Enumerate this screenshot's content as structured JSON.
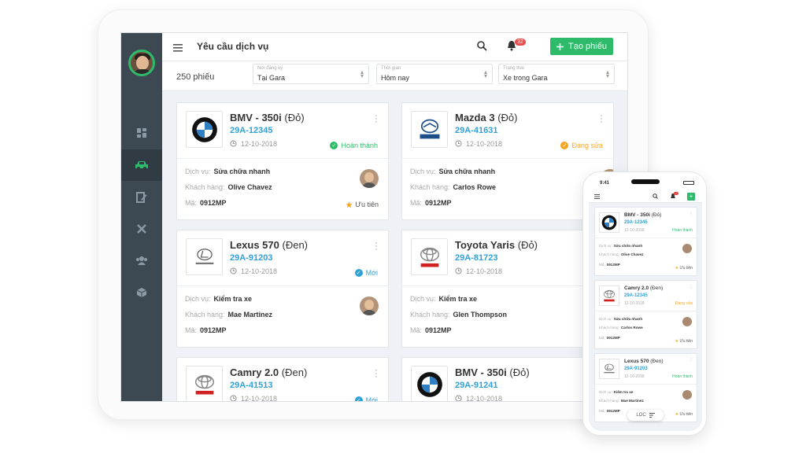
{
  "header": {
    "title": "Yêu cầu dịch vụ",
    "notification_count": "32",
    "create_label": "Tạo phiếu"
  },
  "filters": {
    "count": "250 phiếu",
    "location": {
      "label": "Nơi đăng ký",
      "value": "Tại Gara"
    },
    "time": {
      "label": "Thời gian",
      "value": "Hôm nay"
    },
    "status": {
      "label": "Trạng thái",
      "value": "Xe trong Gara"
    }
  },
  "labels": {
    "service": "Dịch vụ:",
    "customer": "Khách hàng:",
    "code": "Mã:"
  },
  "cards": [
    {
      "brand": "BMW",
      "model": "BMV - 350i",
      "color": "(Đỏ)",
      "plate": "29A-12345",
      "date": "12-10-2018",
      "status": "Hoàn thành",
      "status_color": "#2dbb6a",
      "service": "Sửa chữa nhanh",
      "customer": "Olive Chavez",
      "code": "0912MP",
      "priority": "Ưu tiên"
    },
    {
      "brand": "MAZDA",
      "model": "Mazda 3",
      "color": "(Đỏ)",
      "plate": "29A-41631",
      "date": "12-10-2018",
      "status": "Đang sửa",
      "status_color": "#f5a623",
      "service": "Sửa chữa nhanh",
      "customer": "Carlos Rowe",
      "code": "0912MP",
      "priority": "Ư"
    },
    {
      "brand": "LEXUS",
      "model": "Lexus 570",
      "color": "(Đen)",
      "plate": "29A-91203",
      "date": "12-10-2018",
      "status": "Mới",
      "status_color": "#2fa1d6",
      "service": "Kiểm tra xe",
      "customer": "Mae Martinez",
      "code": "0912MP",
      "priority": ""
    },
    {
      "brand": "TOYOTA",
      "model": "Toyota Yaris",
      "color": "(Đỏ)",
      "plate": "29A-81723",
      "date": "12-10-2018",
      "status": "",
      "status_color": "#2fa1d6",
      "service": "Kiểm tra xe",
      "customer": "Glen Thompson",
      "code": "0912MP",
      "priority": ""
    },
    {
      "brand": "TOYOTA",
      "model": "Camry 2.0",
      "color": "(Đen)",
      "plate": "29A-41513",
      "date": "12-10-2018",
      "status": "Mới",
      "status_color": "#2fa1d6",
      "service": "",
      "customer": "",
      "code": "",
      "priority": ""
    },
    {
      "brand": "BMW",
      "model": "BMV - 350i",
      "color": "(Đỏ)",
      "plate": "29A-91241",
      "date": "12-10-2018",
      "status": "",
      "status_color": "#2fa1d6",
      "service": "",
      "customer": "",
      "code": "",
      "priority": ""
    }
  ],
  "phone": {
    "time": "9:41",
    "filter_label": "LỌC",
    "cards": [
      {
        "brand": "BMW",
        "model": "BMV - 350i",
        "color": "(Đỏ)",
        "plate": "29A-12345",
        "date": "12-10-2018",
        "status": "Hoàn thành",
        "status_color": "#2dbb6a",
        "service": "Sửa chữa nhanh",
        "customer": "Olive Chavez",
        "code": "0912MP",
        "priority": "Ưu tiên"
      },
      {
        "brand": "TOYOTA",
        "model": "Camry 2.0",
        "color": "(Đen)",
        "plate": "29A-12345",
        "date": "12-10-2018",
        "status": "Đang sửa",
        "status_color": "#f5a623",
        "service": "Sửa chữa nhanh",
        "customer": "Carlos Rowe",
        "code": "0912MP",
        "priority": "Ưu tiên"
      },
      {
        "brand": "LEXUS",
        "model": "Lexus 570",
        "color": "(Đen)",
        "plate": "29A-91203",
        "date": "12-10-2018",
        "status": "Hoàn thành",
        "status_color": "#2dbb6a",
        "service": "Kiểm tra xe",
        "customer": "Mae Martinez",
        "code": "0912MP",
        "priority": "Ưu tiên"
      }
    ]
  },
  "icons": [
    "menu-icon",
    "search-icon",
    "bell-icon",
    "plus-icon",
    "dashboard-icon",
    "car-icon",
    "edit-icon",
    "tools-icon",
    "users-icon",
    "box-icon",
    "clock-icon",
    "star-icon",
    "kebab-icon",
    "filter-icon"
  ]
}
